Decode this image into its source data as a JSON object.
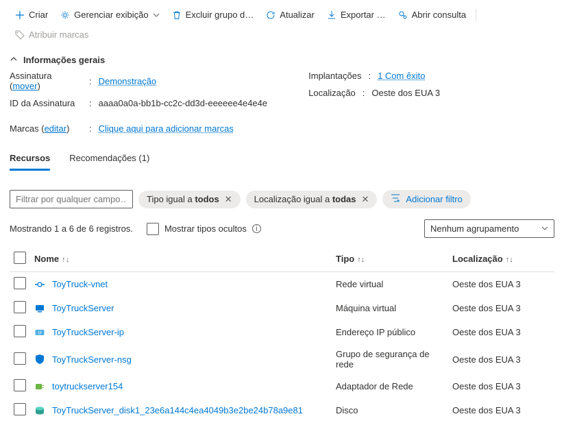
{
  "toolbar": {
    "create": "Criar",
    "manage_view": "Gerenciar exibição",
    "delete_group": "Excluir grupo d…",
    "refresh": "Atualizar",
    "export": "Exportar …",
    "open_query": "Abrir consulta",
    "assign_tags": "Atribuir marcas"
  },
  "section_title": "Informações gerais",
  "kv_left": {
    "subscription_key_pre": "Assinatura (",
    "subscription_move": "mover",
    "subscription_key_post": ")",
    "subscription_val": "Demonstração",
    "sub_id_key": "ID da Assinatura",
    "sub_id_val": "aaaa0a0a-bb1b-cc2c-dd3d-eeeeee4e4e4e",
    "tags_key_pre": "Marcas (",
    "tags_edit": "editar",
    "tags_key_post": ")",
    "tags_val": "Clique aqui para adicionar marcas"
  },
  "kv_right": {
    "deploy_key": "Implantações",
    "deploy_val": "1 Com êxito",
    "loc_key": "Localização",
    "loc_val": "Oeste dos EUA 3"
  },
  "tabs": {
    "resources": "Recursos",
    "recommendations": "Recomendações (1)"
  },
  "filters": {
    "placeholder": "Filtrar por qualquer campo…",
    "type_pre": "Tipo igual a ",
    "type_bold": "todos",
    "loc_pre": "Localização igual a ",
    "loc_bold": "todas",
    "add": "Adicionar filtro"
  },
  "status": {
    "count": "Mostrando 1 a 6 de 6 registros.",
    "show_hidden": "Mostrar tipos ocultos",
    "grouping": "Nenhum agrupamento"
  },
  "cols": {
    "name": "Nome",
    "type": "Tipo",
    "location": "Localização"
  },
  "rows": [
    {
      "name": "ToyTruck-vnet",
      "type": "Rede virtual",
      "location": "Oeste dos EUA 3",
      "icon": "vnet"
    },
    {
      "name": "ToyTruckServer",
      "type": "Máquina virtual",
      "location": "Oeste dos EUA 3",
      "icon": "vm"
    },
    {
      "name": "ToyTruckServer-ip",
      "type": "Endereço IP público",
      "location": "Oeste dos EUA 3",
      "icon": "ip"
    },
    {
      "name": "ToyTruckServer-nsg",
      "type": "Grupo de segurança de rede",
      "location": "Oeste dos EUA 3",
      "icon": "nsg"
    },
    {
      "name": "toytruckserver154",
      "type": "Adaptador de Rede",
      "location": "Oeste dos EUA 3",
      "icon": "nic"
    },
    {
      "name": "ToyTruckServer_disk1_23e6a144c4ea4049b3e2be24b78a9e81",
      "type": "Disco",
      "location": "Oeste dos EUA 3",
      "icon": "disk"
    }
  ]
}
